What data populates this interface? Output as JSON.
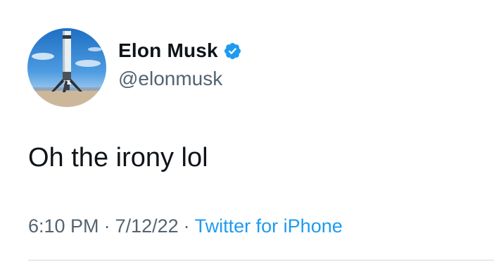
{
  "author": {
    "display_name": "Elon Musk",
    "handle": "@elonmusk",
    "verified": true,
    "avatar_icon": "rocket-avatar"
  },
  "tweet": {
    "text": "Oh the irony lol"
  },
  "meta": {
    "time": "6:10 PM",
    "separator": "·",
    "date": "7/12/22",
    "source": "Twitter for iPhone"
  },
  "colors": {
    "text": "#0f1419",
    "secondary": "#536471",
    "accent": "#1d9bf0",
    "divider": "#cfd9de"
  }
}
